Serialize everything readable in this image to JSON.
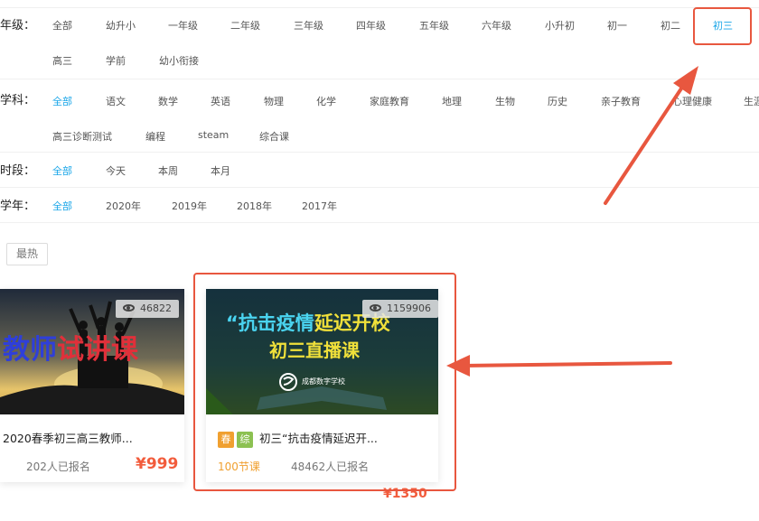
{
  "filters": {
    "grade": {
      "label": "年级：",
      "options_row1": [
        "全部",
        "幼升小",
        "一年级",
        "二年级",
        "三年级",
        "四年级",
        "五年级",
        "六年级",
        "小升初",
        "初一",
        "初二",
        "初三"
      ],
      "options_row2": [
        "高三",
        "学前",
        "幼小衔接"
      ],
      "active": "初三"
    },
    "subject": {
      "label": "学科：",
      "options_row1": [
        "全部",
        "语文",
        "数学",
        "英语",
        "物理",
        "化学",
        "家庭教育",
        "地理",
        "生物",
        "历史",
        "亲子教育",
        "心理健康",
        "生涯"
      ],
      "options_row2": [
        "高三诊断测试",
        "编程",
        "steam",
        "综合课"
      ],
      "active": "全部"
    },
    "period": {
      "label": "时段：",
      "options": [
        "全部",
        "今天",
        "本周",
        "本月"
      ],
      "active": "全部"
    },
    "year": {
      "label": "学年：",
      "options": [
        "全部",
        "2020年",
        "2019年",
        "2018年",
        "2017年"
      ],
      "active": "全部"
    }
  },
  "sort": {
    "label": "最热"
  },
  "courses": [
    {
      "banner_text_part1": "教师",
      "banner_text_part2": "试讲课",
      "views": "46822",
      "title": "2020春季初三高三教师...",
      "enrolled": "202人已报名",
      "price": "¥999"
    },
    {
      "banner_line1_a": "“抗击疫情",
      "banner_line1_b": "延迟开校",
      "banner_line2": "初三直播课",
      "banner_school": "成都数字学校",
      "views": "1159906",
      "tags": [
        "春",
        "综"
      ],
      "title": "初三“抗击疫情延迟开...",
      "lessons": "100节课",
      "enrolled": "48462人已报名",
      "price": "¥1350"
    }
  ],
  "colors": {
    "active": "#1aa6e8",
    "price": "#f25c3c",
    "annotation_red": "#e8573f",
    "tag_spring": "#f0a030",
    "tag_general": "#8cc152"
  }
}
